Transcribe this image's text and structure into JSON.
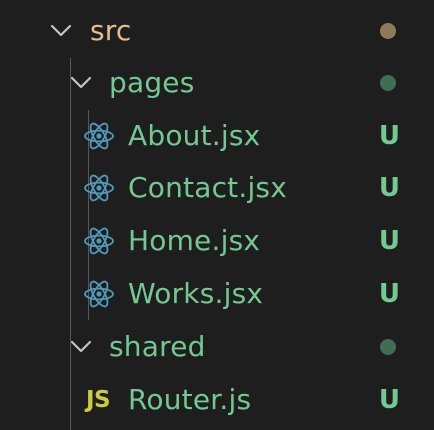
{
  "explorer": {
    "src": {
      "label": "src",
      "decoration_color": "#8c7a5a",
      "icon": "chevron-down-icon"
    },
    "pages": {
      "label": "pages",
      "decoration_color": "#3f6e55",
      "icon": "chevron-down-icon"
    },
    "pages_files": [
      {
        "label": "About.jsx",
        "status": "U",
        "icon": "react-icon"
      },
      {
        "label": "Contact.jsx",
        "status": "U",
        "icon": "react-icon"
      },
      {
        "label": "Home.jsx",
        "status": "U",
        "icon": "react-icon"
      },
      {
        "label": "Works.jsx",
        "status": "U",
        "icon": "react-icon"
      }
    ],
    "shared": {
      "label": "shared",
      "decoration_color": "#3f6e55",
      "icon": "chevron-down-icon"
    },
    "shared_files": [
      {
        "label": "Router.js",
        "status": "U",
        "icon": "js-icon",
        "icon_text": "JS"
      }
    ]
  },
  "colors": {
    "background": "#1e1e1e",
    "folder_src": "#e2c08d",
    "untracked": "#73c991",
    "react": "#519aba",
    "js": "#cbcb41"
  }
}
